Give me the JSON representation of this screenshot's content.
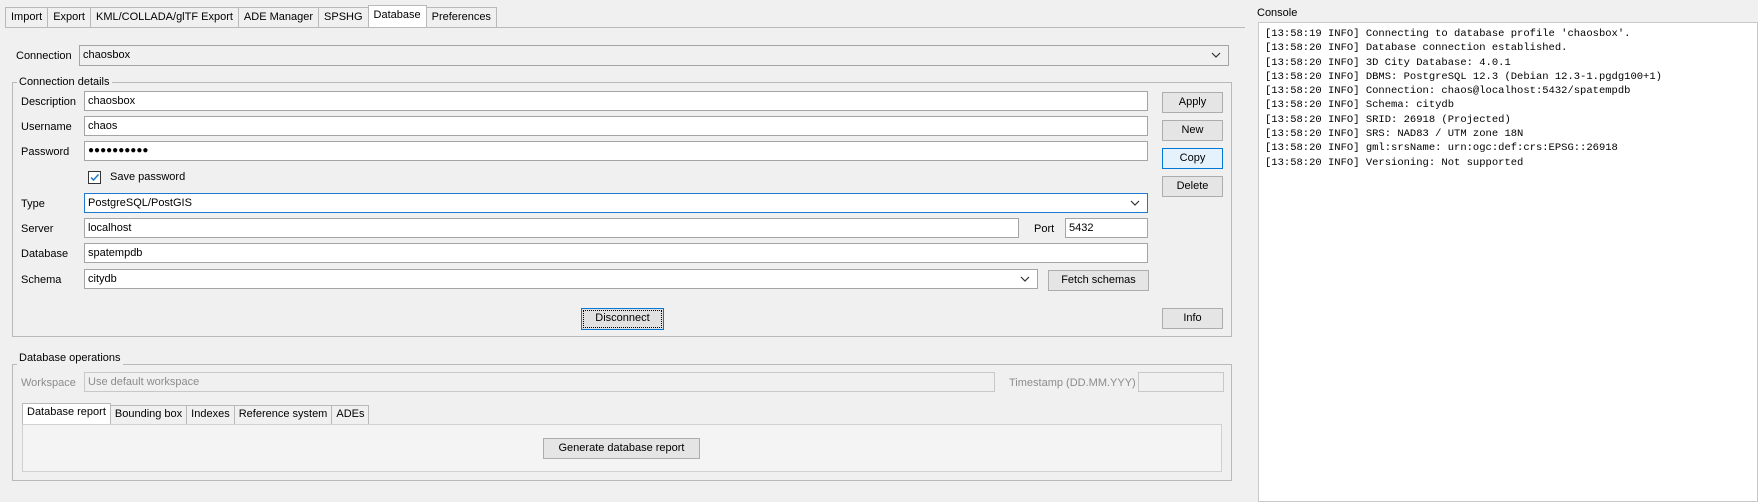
{
  "tabs": [
    "Import",
    "Export",
    "KML/COLLADA/glTF Export",
    "ADE Manager",
    "SPSHG",
    "Database",
    "Preferences"
  ],
  "active_tab": "Database",
  "connection": {
    "label": "Connection",
    "value": "chaosbox"
  },
  "details": {
    "title": "Connection details",
    "description_label": "Description",
    "description": "chaosbox",
    "username_label": "Username",
    "username": "chaos",
    "password_label": "Password",
    "password": "●●●●●●●●●●",
    "save_password_label": "Save password",
    "type_label": "Type",
    "type": "PostgreSQL/PostGIS",
    "server_label": "Server",
    "server": "localhost",
    "port_label": "Port",
    "port": "5432",
    "database_label": "Database",
    "database": "spatempdb",
    "schema_label": "Schema",
    "schema": "citydb",
    "buttons": {
      "apply": "Apply",
      "new": "New",
      "copy": "Copy",
      "delete": "Delete",
      "fetch": "Fetch schemas",
      "disconnect": "Disconnect",
      "info": "Info"
    }
  },
  "operations": {
    "title": "Database operations",
    "workspace_label": "Workspace",
    "workspace_placeholder": "Use default workspace",
    "timestamp_label": "Timestamp (DD.MM.YYY)",
    "tabs": [
      "Database report",
      "Bounding box",
      "Indexes",
      "Reference system",
      "ADEs"
    ],
    "generate": "Generate database report"
  },
  "console": {
    "title": "Console",
    "lines": [
      "[13:58:19 INFO] Connecting to database profile 'chaosbox'.",
      "[13:58:20 INFO] Database connection established.",
      "[13:58:20 INFO] 3D City Database: 4.0.1",
      "[13:58:20 INFO] DBMS: PostgreSQL 12.3 (Debian 12.3-1.pgdg100+1)",
      "[13:58:20 INFO] Connection: chaos@localhost:5432/spatempdb",
      "[13:58:20 INFO] Schema: citydb",
      "[13:58:20 INFO] SRID: 26918 (Projected)",
      "[13:58:20 INFO] SRS: NAD83 / UTM zone 18N",
      "[13:58:20 INFO] gml:srsName: urn:ogc:def:crs:EPSG::26918",
      "[13:58:20 INFO] Versioning: Not supported"
    ]
  },
  "colors": {
    "focus": "#1e7ad1",
    "background": "#f0f0f0"
  }
}
